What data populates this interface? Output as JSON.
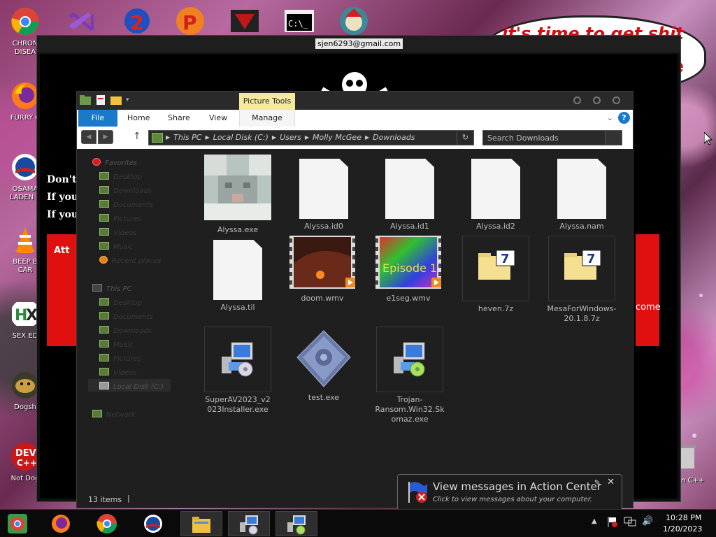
{
  "desktop": {
    "icons": [
      {
        "label": "CHRON\nDISEA"
      },
      {
        "label": "FURRY C"
      },
      {
        "label": "OSAMA\nLADEN B"
      },
      {
        "label": "BEEP B\nCAR"
      },
      {
        "label": "SEX ED"
      },
      {
        "label": "Dogsh"
      },
      {
        "label": "Not Dog"
      }
    ],
    "right_labels": [
      "n C++"
    ],
    "bubble_text": "it's time to get shit",
    "bubble_te": "te"
  },
  "ransom_window": {
    "title": "sjen6293@gmail.com",
    "line1": "Don't",
    "line2": "If you",
    "line3": "If you",
    "red_left": "Att",
    "red_right": "come"
  },
  "explorer": {
    "ribbon": {
      "file": "File",
      "home": "Home",
      "share": "Share",
      "view": "View",
      "picture_tools": "Picture Tools",
      "manage": "Manage"
    },
    "breadcrumbs": [
      "This PC",
      "Local Disk (C:)",
      "Users",
      "Molly McGee",
      "Downloads"
    ],
    "search_placeholder": "Search Downloads",
    "nav": {
      "favorites": "Favorites",
      "fav_items": [
        "Desktop",
        "Downloads",
        "Documents",
        "Pictures",
        "Videos",
        "Music",
        "Recent places"
      ],
      "this_pc": "This PC",
      "pc_items": [
        "Desktop",
        "Documents",
        "Downloads",
        "Music",
        "Pictures",
        "Videos",
        "Local Disk (C:)"
      ],
      "network": "Network"
    },
    "files": [
      {
        "name": "Alyssa.exe",
        "kind": "cat"
      },
      {
        "name": "Alyssa.id0",
        "kind": "doc"
      },
      {
        "name": "Alyssa.id1",
        "kind": "doc"
      },
      {
        "name": "Alyssa.id2",
        "kind": "doc"
      },
      {
        "name": "Alyssa.nam",
        "kind": "doc"
      },
      {
        "name": "Alyssa.til",
        "kind": "doc"
      },
      {
        "name": "doom.wmv",
        "kind": "video-doom"
      },
      {
        "name": "e1seg.wmv",
        "kind": "video-e1"
      },
      {
        "name": "heven.7z",
        "kind": "7z"
      },
      {
        "name": "MesaForWindows-20.1.8.7z",
        "kind": "7z"
      },
      {
        "name": "SuperAV2023_v2023Installer.exe",
        "kind": "installer"
      },
      {
        "name": "test.exe",
        "kind": "exe"
      },
      {
        "name": "Trojan-Ransom.Win32.Skomaz.exe",
        "kind": "installer"
      }
    ],
    "video_caption": "Episode 1",
    "status_count": "13 items"
  },
  "action_center": {
    "title": "View messages in Action Center",
    "subtitle": "Click to view messages about your computer."
  },
  "taskbar": {
    "time": "10:28 PM",
    "date": "1/20/2023"
  },
  "colors": {
    "accent": "#1979ca",
    "picture_tools": "#f5e9a0",
    "ransom_red": "#e01010",
    "explorer_bg": "#1f1f1f"
  }
}
